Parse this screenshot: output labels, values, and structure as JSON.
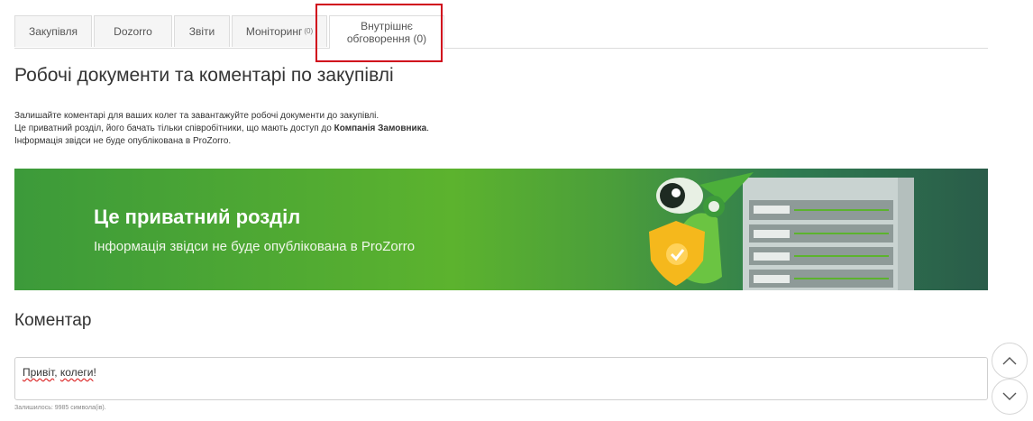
{
  "tabs": [
    {
      "label": "Закупівля",
      "count": ""
    },
    {
      "label": "Dozorro",
      "count": ""
    },
    {
      "label": "Звіти",
      "count": ""
    },
    {
      "label": "Моніторинг",
      "count": "(0)"
    },
    {
      "label_line1": "Внутрішнє",
      "label_line2": "обговорення (0)",
      "active": true
    }
  ],
  "page_title": "Робочі документи та коментарі по закупівлі",
  "intro": {
    "line1": "Залишайте коментарі для ваших колег та завантажуйте робочі документи до закупівлі.",
    "line2_prefix": "Це приватний розділ, його бачать тільки співробітники, що мають доступ до ",
    "line2_bold": "Компанія Замовника",
    "line2_suffix": ".",
    "line3": "Інформація звідси не буде опублікована в ProZorro."
  },
  "banner": {
    "title": "Це приватний розділ",
    "subtitle": "Інформація звідси не буде опублікована в ProZorro"
  },
  "comment": {
    "heading": "Коментар",
    "word1": "Привіт",
    "sep": ", ",
    "word2": "колеги",
    "end": "!",
    "remaining": "Залишилось: 9985 символа(ів)."
  },
  "colors": {
    "accent_border": "#d0021b",
    "banner_green": "#5cb32e"
  },
  "icons": {
    "scroll_up": "chevron-up-icon",
    "scroll_down": "chevron-down-icon",
    "banner": "robot-shield-illustration"
  }
}
